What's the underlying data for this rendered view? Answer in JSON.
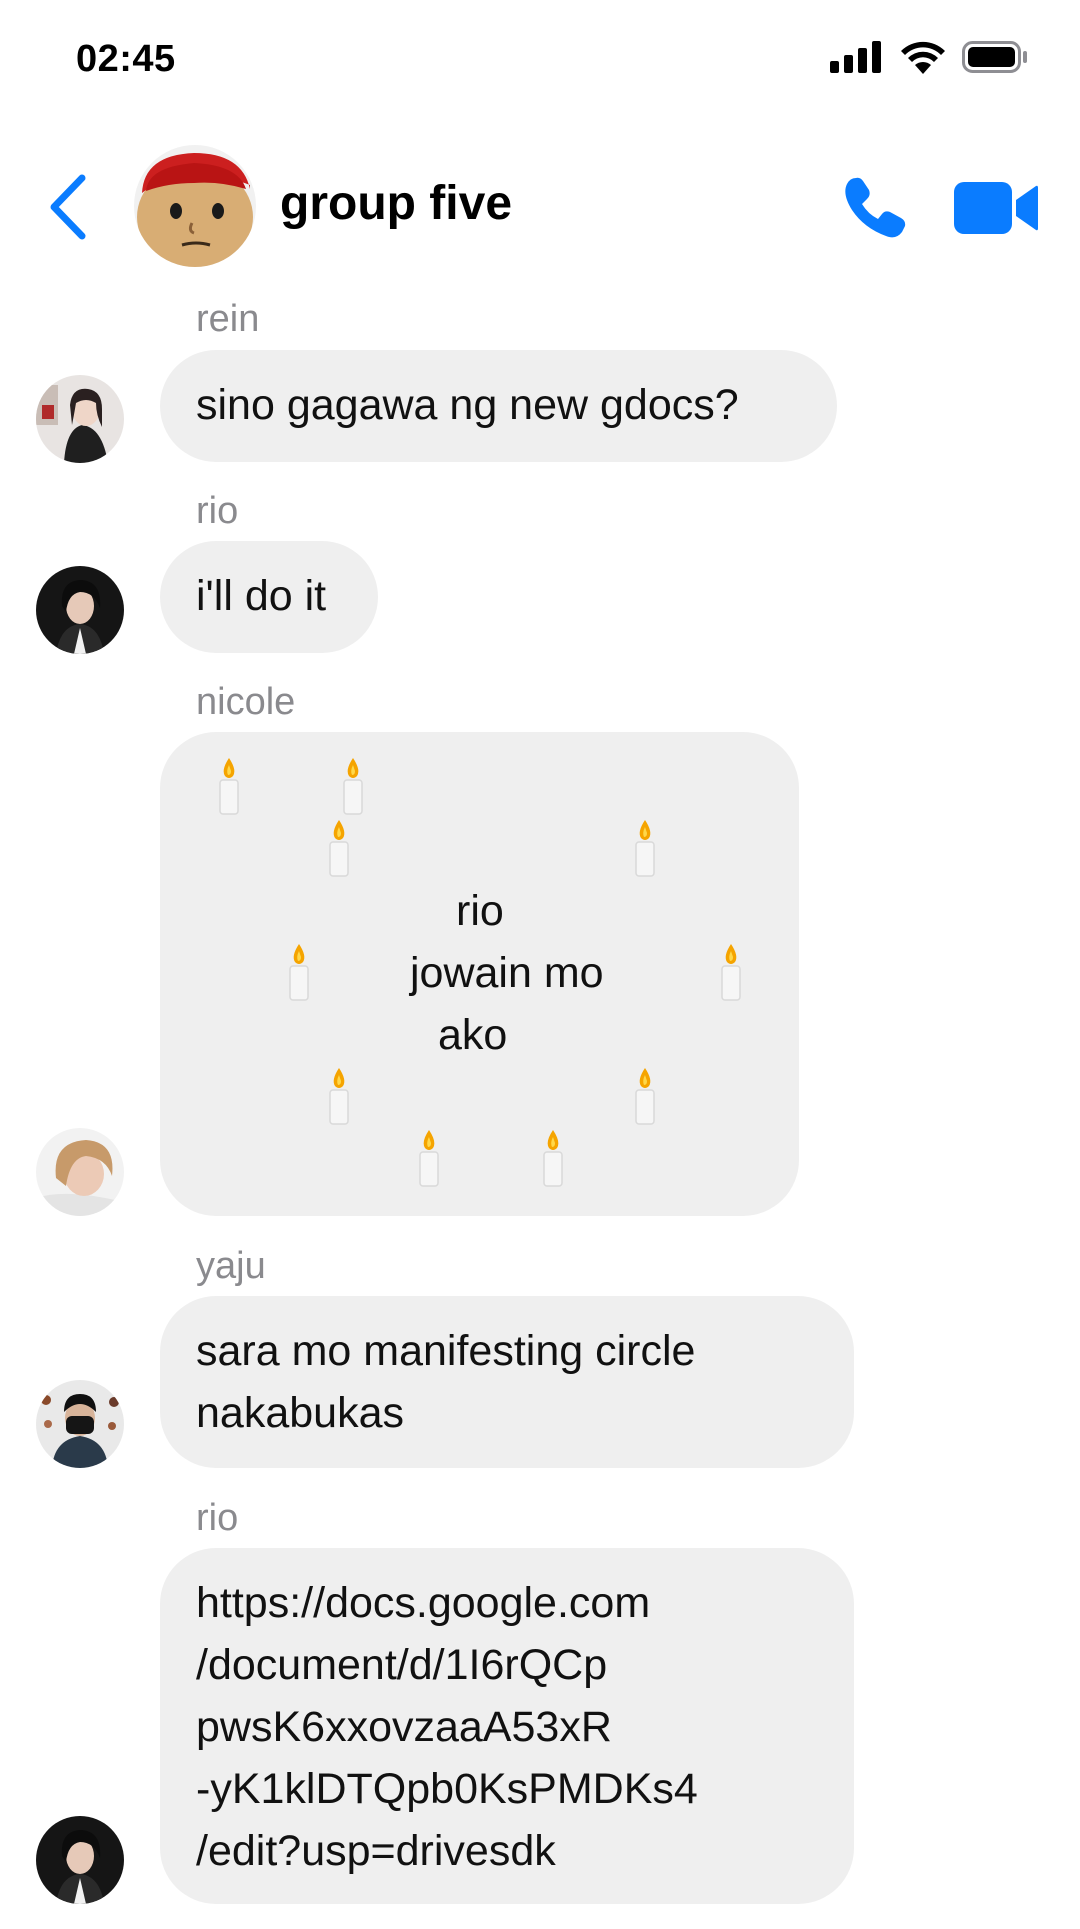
{
  "status_bar": {
    "time": "02:45",
    "icons": [
      "cellular-signal-icon",
      "wifi-icon",
      "battery-icon"
    ]
  },
  "header": {
    "title": "group five",
    "back_icon": "chevron-left-icon",
    "call_icon": "phone-icon",
    "video_icon": "video-camera-icon"
  },
  "colors": {
    "accent": "#0a7cff",
    "bubble": "#efefef",
    "sender_name": "#8a8a8e"
  },
  "messages": [
    {
      "sender": "rein",
      "text": "sino gagawa ng new gdocs?"
    },
    {
      "sender": "rio",
      "text": "i'll do it"
    },
    {
      "sender": "nicole",
      "text_lines": [
        "rio",
        "jowain mo",
        "ako"
      ],
      "decoration": "candle-icon"
    },
    {
      "sender": "yaju",
      "text_lines": [
        "sara mo manifesting circle",
        "nakabukas"
      ]
    },
    {
      "sender": "rio",
      "text_lines": [
        "https://docs.google.com",
        "/document/d/1I6rQCp",
        "pwsK6xxovzaaA53xR",
        "-yK1klDTQpb0KsPMDKs4",
        "/edit?usp=drivesdk"
      ]
    }
  ]
}
